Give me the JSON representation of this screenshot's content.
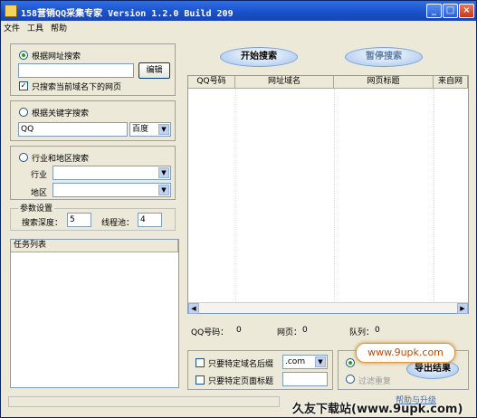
{
  "window": {
    "title": "158营销QQ采集专家 Version 1.2.0 Build 209"
  },
  "menu": [
    "文件",
    "工具",
    "帮助"
  ],
  "url_search": {
    "label": "根据网址搜索",
    "url_value": "",
    "edit_button": "编辑",
    "only_domain_label": "只搜索当前域名下的网页",
    "only_domain_checked": true
  },
  "keyword_search": {
    "label": "根据关键字搜索",
    "keyword_value": "QQ",
    "engine_selected": "百度"
  },
  "region_search": {
    "label": "行业和地区搜索",
    "industry_label": "行业",
    "industry_selected": "",
    "region_label": "地区",
    "region_selected": ""
  },
  "params": {
    "group_label": "参数设置",
    "depth_label": "搜索深度：",
    "depth_value": "5",
    "threads_label": "线程池：",
    "threads_value": "4"
  },
  "task_list": {
    "label": "任务列表"
  },
  "actions": {
    "start_label": "开始搜索",
    "pause_label": "暂停搜索"
  },
  "results_table": {
    "columns": [
      "QQ号码",
      "网址域名",
      "网页标题",
      "来自网"
    ]
  },
  "stats": {
    "qq_label": "QQ号码：",
    "qq_value": "0",
    "pages_label": "网页：",
    "pages_value": "0",
    "queue_label": "队列：",
    "queue_value": "0"
  },
  "filters": {
    "suffix_label": "只要特定域名后缀",
    "suffix_value": ".com",
    "title_label": "只要特定页面标题",
    "title_value": "",
    "filter_dup_label": "过滤重复"
  },
  "export_label": "导出结果",
  "help_link": "帮助与升级",
  "watermark": {
    "url": "www.9upk.com",
    "banner": "久友下载站(www.9upk.com)"
  }
}
